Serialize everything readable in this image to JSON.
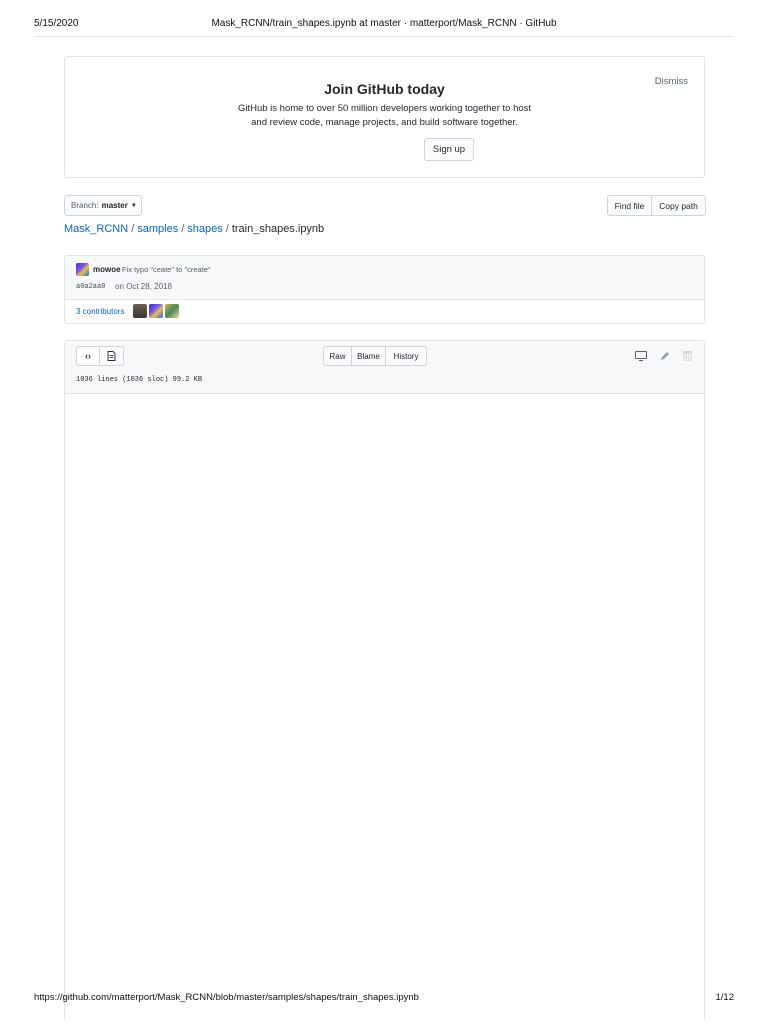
{
  "print_header": {
    "date": "5/15/2020",
    "title": "Mask_RCNN/train_shapes.ipynb at master · matterport/Mask_RCNN · GitHub"
  },
  "signup": {
    "dismiss": "Dismiss",
    "heading": "Join GitHub today",
    "line1": "GitHub is home to over 50 million developers working together to host",
    "line2": "and review code, manage projects, and build software together.",
    "button": "Sign up"
  },
  "branch": {
    "label": "Branch:",
    "value": "master"
  },
  "file_actions": {
    "find_file": "Find file",
    "copy_path": "Copy path"
  },
  "breadcrumb": {
    "repo": "Mask_RCNN",
    "dir1": "samples",
    "dir2": "shapes",
    "file": "train_shapes.ipynb",
    "separator": "/"
  },
  "commit": {
    "author": "mowoe",
    "message": "Fix typo \"ceate\" to \"create\"",
    "sha": "a0a2aa0",
    "date": "on Oct 28, 2018",
    "contributors": "3 contributors"
  },
  "file": {
    "raw": "Raw",
    "blame": "Blame",
    "history": "History",
    "info": "1036 lines (1036 sloc)   99.2 KB",
    "icons": [
      "code-icon",
      "file-text-icon",
      "desktop-icon",
      "pencil-icon",
      "trash-icon"
    ]
  },
  "print_footer": {
    "url": "https://github.com/matterport/Mask_RCNN/blob/master/samples/shapes/train_shapes.ipynb",
    "pages": "1/12"
  }
}
